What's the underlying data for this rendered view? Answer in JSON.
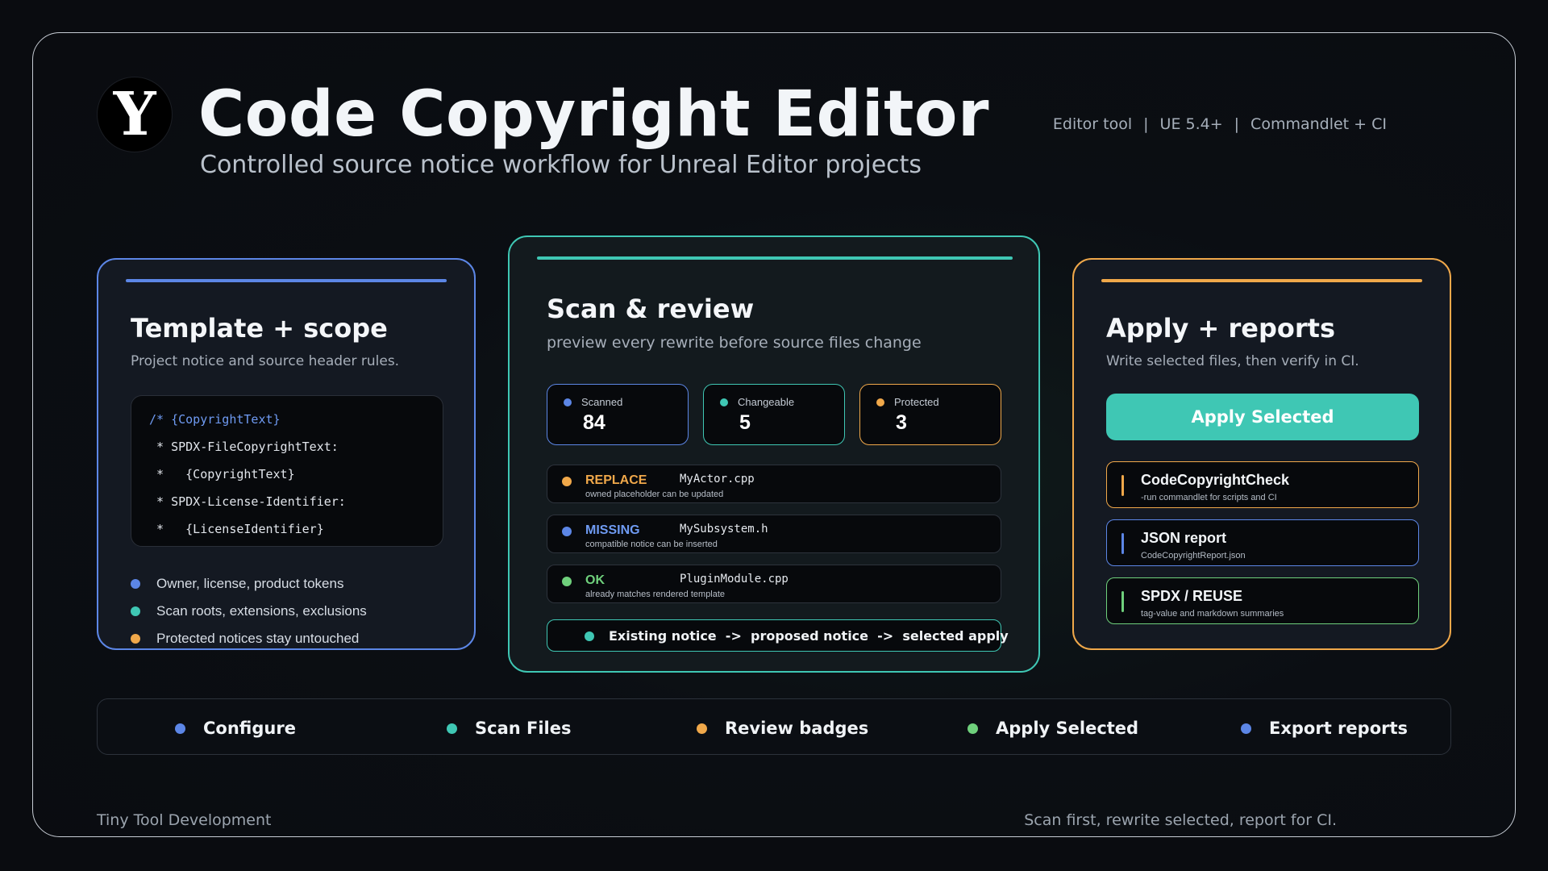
{
  "header": {
    "logo_letter": "Y",
    "title": "Code Copyright Editor",
    "subtitle": "Controlled source notice workflow for Unreal Editor projects",
    "meta": [
      "Editor tool",
      "UE 5.4+",
      "Commandlet + CI"
    ],
    "meta_separator": "|"
  },
  "colors": {
    "blue": "#5c86e6",
    "teal": "#3fc7b4",
    "orange": "#f0a84a",
    "green": "#6fd07c"
  },
  "template_card": {
    "title": "Template + scope",
    "description": "Project notice and source header rules.",
    "code_lines": [
      "/* {CopyrightText}",
      " * SPDX-FileCopyrightText:",
      " *   {CopyrightText}",
      " * SPDX-License-Identifier:",
      " *   {LicenseIdentifier}"
    ],
    "bullets": [
      {
        "text": "Owner, license, product tokens",
        "color": "#5c86e6"
      },
      {
        "text": "Scan roots, extensions, exclusions",
        "color": "#3fc7b4"
      },
      {
        "text": "Protected notices stay untouched",
        "color": "#f0a84a"
      }
    ]
  },
  "scan_card": {
    "title": "Scan & review",
    "description": "preview every rewrite before source files change",
    "stats": [
      {
        "label": "Scanned",
        "value": "84",
        "color": "#5c86e6"
      },
      {
        "label": "Changeable",
        "value": "5",
        "color": "#3fc7b4"
      },
      {
        "label": "Protected",
        "value": "3",
        "color": "#f0a84a"
      }
    ],
    "rows": [
      {
        "tag": "REPLACE",
        "file": "MyActor.cpp",
        "note": "owned placeholder can be updated",
        "color": "#f0a84a"
      },
      {
        "tag": "MISSING",
        "file": "MySubsystem.h",
        "note": "compatible notice can be inserted",
        "color": "#5c86e6"
      },
      {
        "tag": "OK",
        "file": "PluginModule.cpp",
        "note": "already matches rendered template",
        "color": "#6fd07c"
      }
    ],
    "flow": "Existing notice  ->  proposed notice  ->  selected apply"
  },
  "apply_card": {
    "title": "Apply + reports",
    "description": "Write selected files, then verify in CI.",
    "button_label": "Apply Selected",
    "outputs": [
      {
        "name": "CodeCopyrightCheck",
        "sub": "-run commandlet for scripts and CI",
        "color": "#f0a84a"
      },
      {
        "name": "JSON report",
        "sub": "CodeCopyrightReport.json",
        "color": "#5c86e6"
      },
      {
        "name": "SPDX / REUSE",
        "sub": "tag-value and markdown summaries",
        "color": "#6fd07c"
      }
    ]
  },
  "steps": [
    {
      "label": "Configure",
      "color": "#5c86e6"
    },
    {
      "label": "Scan Files",
      "color": "#3fc7b4"
    },
    {
      "label": "Review badges",
      "color": "#f0a84a"
    },
    {
      "label": "Apply Selected",
      "color": "#6fd07c"
    },
    {
      "label": "Export reports",
      "color": "#5c86e6"
    }
  ],
  "footer": {
    "left": "Tiny Tool Development",
    "right": "Scan first, rewrite selected, report for CI."
  }
}
